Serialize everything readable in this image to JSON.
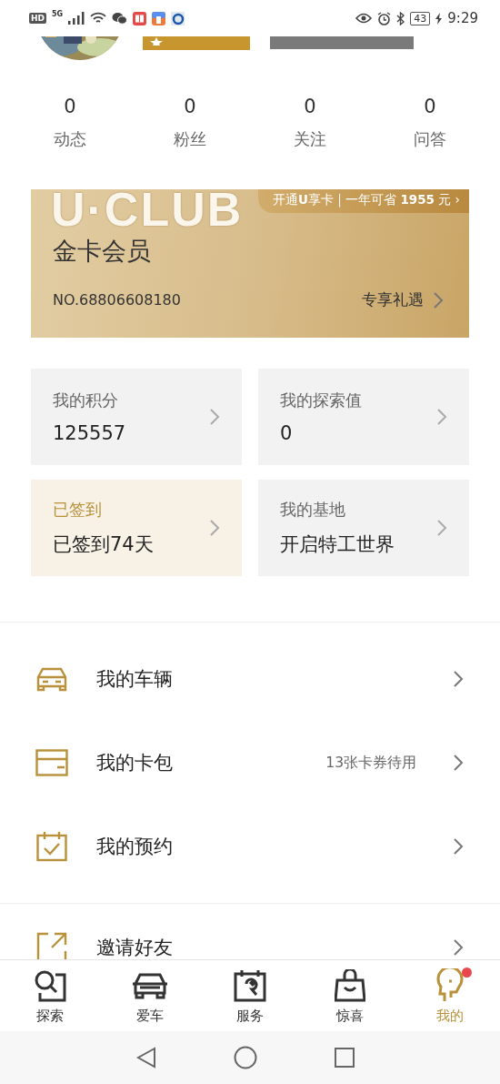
{
  "status_bar": {
    "network": "HD",
    "generation": "5G",
    "battery": "43",
    "time": "9:29"
  },
  "stats": [
    {
      "value": "0",
      "label": "动态"
    },
    {
      "value": "0",
      "label": "粉丝"
    },
    {
      "value": "0",
      "label": "关注"
    },
    {
      "value": "0",
      "label": "问答"
    }
  ],
  "member_card": {
    "brand": "U·CLUB",
    "promo": "开通**U**享卡 | 一年可省 **1955** 元 ›",
    "title": "金卡会员",
    "number": "NO.68806608180",
    "benefits_link": "专享礼遇"
  },
  "tiles": [
    {
      "label": "我的积分",
      "value": "125557",
      "highlighted": false
    },
    {
      "label": "我的探索值",
      "value": "0",
      "highlighted": false
    },
    {
      "label": "已签到",
      "value": "已签到74天",
      "highlighted": true
    },
    {
      "label": "我的基地",
      "value": "开启特工世界",
      "highlighted": false
    }
  ],
  "menu_groups": [
    [
      {
        "label": "我的车辆"
      },
      {
        "label": "我的卡包",
        "note": "13张卡券待用"
      },
      {
        "label": "我的预约"
      }
    ],
    [
      {
        "label": "邀请好友"
      }
    ]
  ],
  "tab_bar": [
    {
      "label": "探索",
      "selected": false,
      "badge": false
    },
    {
      "label": "爱车",
      "selected": false,
      "badge": false
    },
    {
      "label": "服务",
      "selected": false,
      "badge": false
    },
    {
      "label": "惊喜",
      "selected": false,
      "badge": false
    },
    {
      "label": "我的",
      "selected": true,
      "badge": true
    }
  ]
}
